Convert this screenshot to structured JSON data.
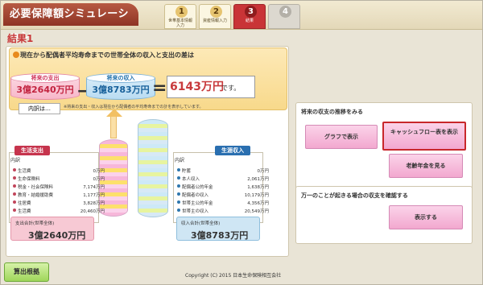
{
  "header": {
    "title": "必要保障額シミュレーション",
    "steps": [
      {
        "num": "1",
        "label": "世帯基本情報入力",
        "state": "done"
      },
      {
        "num": "2",
        "label": "資産情報入力",
        "state": "done"
      },
      {
        "num": "3",
        "label": "結果",
        "state": "active"
      },
      {
        "num": "4",
        "label": "",
        "state": "disabled"
      }
    ]
  },
  "result": {
    "label": "結果1"
  },
  "summary": {
    "question": "現在から配偶者平均寿命までの世帯全体の収入と支出の差は",
    "expense_cap": "将来の支出",
    "expense_value": "3億2640万円",
    "income_cap": "将来の収入",
    "income_value": "3億8783万円",
    "difference": "6143万円",
    "difference_suffix": "です。",
    "breakdown_label": "内訳は…",
    "note": "※将来の支出・収入は現在から配偶者の平均寿命までの計を表示しています。"
  },
  "expense": {
    "head": "生活支出",
    "title": "内訳",
    "rows": [
      {
        "name": "生活費",
        "value": "0万円"
      },
      {
        "name": "生命保険料",
        "value": "0万円"
      },
      {
        "name": "税金・社会保険料",
        "value": "7,174万円"
      },
      {
        "name": "教育・結婚援助費",
        "value": "1,177万円"
      },
      {
        "name": "住居費",
        "value": "3,828万円"
      },
      {
        "name": "生活費",
        "value": "20,460万円"
      }
    ],
    "total_label": "支出合計(世帯全体)",
    "total_value": "3億2640万円"
  },
  "income": {
    "head": "生涯収入",
    "title": "内訳",
    "rows": [
      {
        "name": "貯蓄",
        "value": "0万円"
      },
      {
        "name": "本人収入",
        "value": "2,061万円"
      },
      {
        "name": "配偶者公的年金",
        "value": "1,638万円"
      },
      {
        "name": "配偶者の収入",
        "value": "10,179万円"
      },
      {
        "name": "世帯主公的年金",
        "value": "4,356万円"
      },
      {
        "name": "世帯主の収入",
        "value": "20,549万円"
      }
    ],
    "total_label": "収入合計(世帯全体)",
    "total_value": "3億8783万円"
  },
  "future_panel": {
    "head": "将来の収支の推移をみる",
    "graph_btn": "グラフで表示",
    "cashflow_btn": "キャッシュフロー表を表示",
    "pension_btn": "老齢年金を見る"
  },
  "risk_panel": {
    "head": "万一のことが起きる場合の収支を確認する",
    "show_btn": "表示する"
  },
  "footer": {
    "calc_btn": "算出根拠",
    "copyright": "Copyright (C) 2015 日本生命保険相互会社"
  }
}
